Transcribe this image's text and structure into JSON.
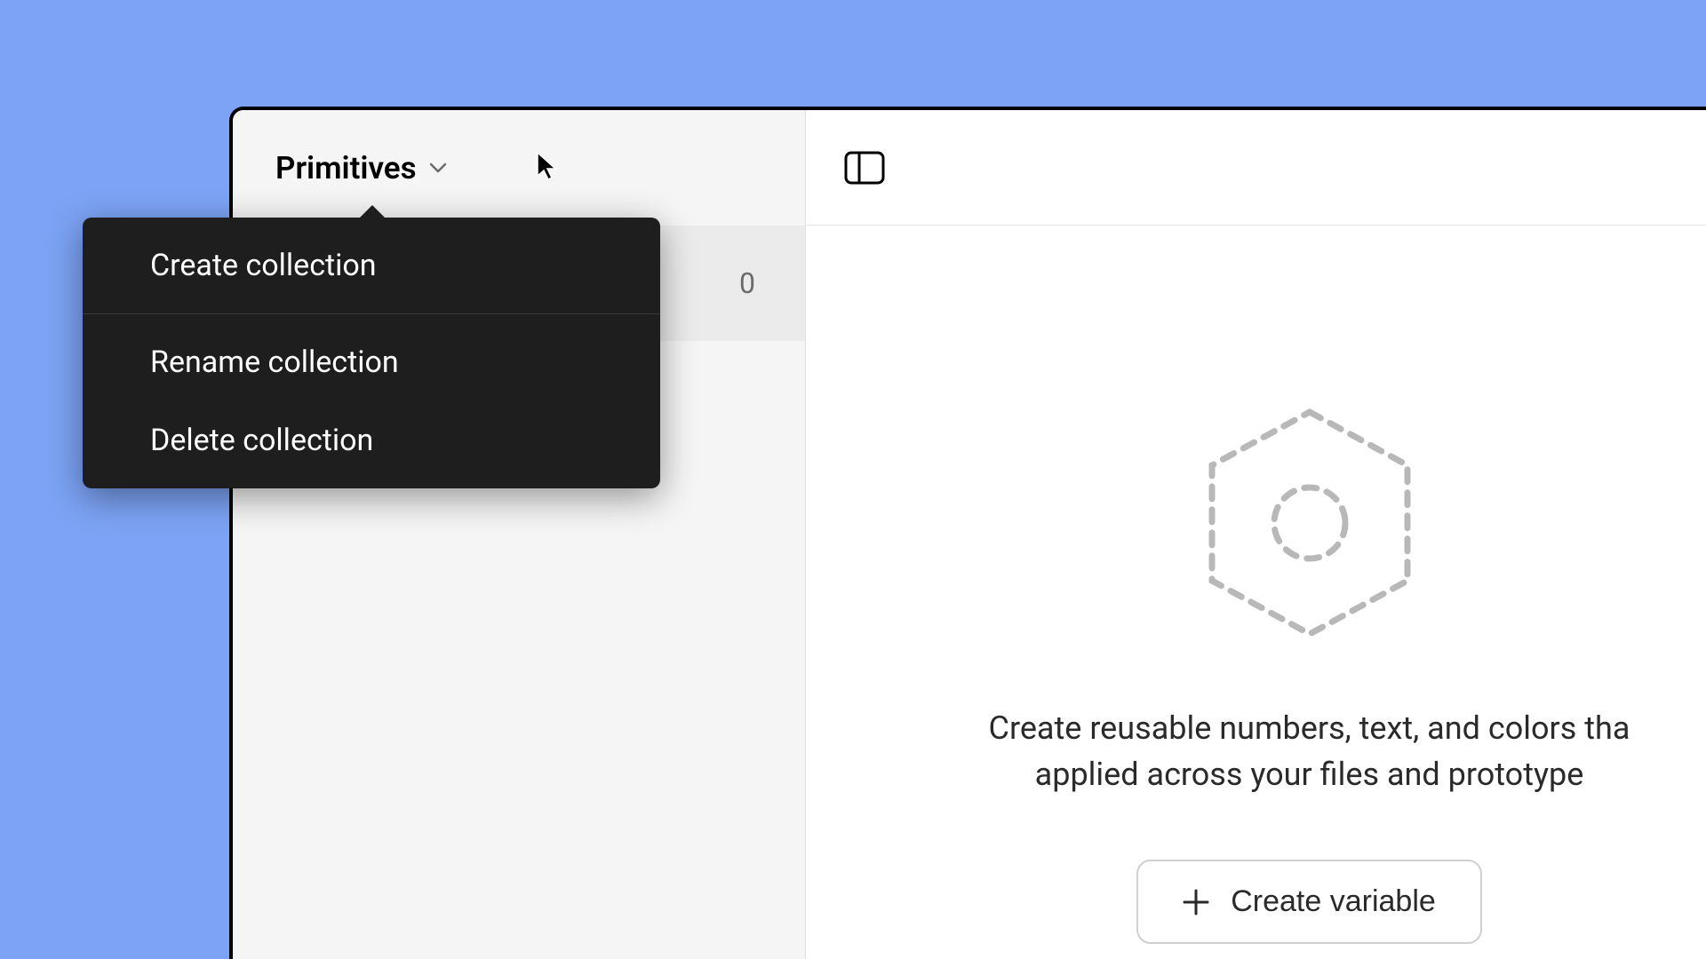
{
  "sidebar": {
    "collection_name": "Primitives",
    "count": "0"
  },
  "context_menu": {
    "create": "Create collection",
    "rename": "Rename collection",
    "delete": "Delete collection"
  },
  "empty_state": {
    "line1": "Create reusable numbers, text, and colors tha",
    "line2": "applied across your files and prototype",
    "button_label": "Create variable"
  },
  "icons": {
    "chevron": "chevron-down-icon",
    "panel_toggle": "panel-toggle-icon",
    "hexagon": "hexagon-icon",
    "plus": "plus-icon"
  }
}
